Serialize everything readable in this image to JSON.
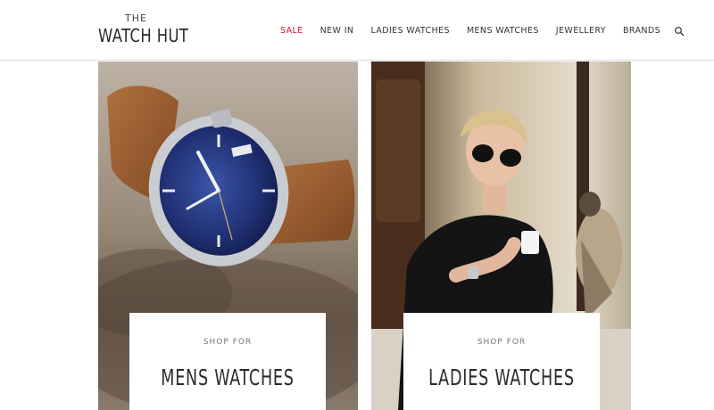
{
  "header": {
    "logo": {
      "top": "THE",
      "main": "WATCH HUT"
    },
    "nav": [
      {
        "label": "SALE",
        "highlight": true
      },
      {
        "label": "NEW IN"
      },
      {
        "label": "LADIES WATCHES"
      },
      {
        "label": "MENS WATCHES"
      },
      {
        "label": "JEWELLERY"
      },
      {
        "label": "BRANDS"
      }
    ],
    "search_icon": "search-icon"
  },
  "tiles": [
    {
      "eyebrow": "SHOP FOR",
      "title": "MENS WATCHES",
      "image": "certina-watch-blue-dial-brown-strap"
    },
    {
      "eyebrow": "SHOP FOR",
      "title": "LADIES WATCHES",
      "image": "woman-sunglasses-with-falcon"
    }
  ],
  "colors": {
    "sale": "#c8102e",
    "text": "#333333",
    "card_bg": "#ffffff"
  }
}
